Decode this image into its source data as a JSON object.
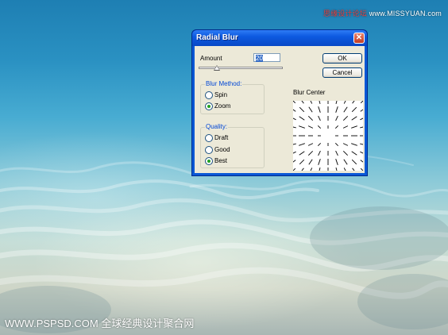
{
  "watermark": {
    "top_prefix": "思缘设计论坛",
    "top_site": "www.MISSYUAN.com",
    "bottom": "WWW.PSPSD.COM 全球经典设计聚合网"
  },
  "dialog": {
    "title": "Radial Blur",
    "amount_label": "Amount",
    "amount_value": "20",
    "ok_label": "OK",
    "cancel_label": "Cancel",
    "blur_method": {
      "title": "Blur Method:",
      "options": [
        "Spin",
        "Zoom"
      ],
      "selected": "Zoom"
    },
    "quality": {
      "title": "Quality:",
      "options": [
        "Draft",
        "Good",
        "Best"
      ],
      "selected": "Best"
    },
    "blur_center_label": "Blur Center"
  },
  "colors": {
    "title_bar": "#0a58d6",
    "dialog_face": "#ece9d8",
    "group_title": "#0046d5",
    "close_button": "#c23c22"
  }
}
